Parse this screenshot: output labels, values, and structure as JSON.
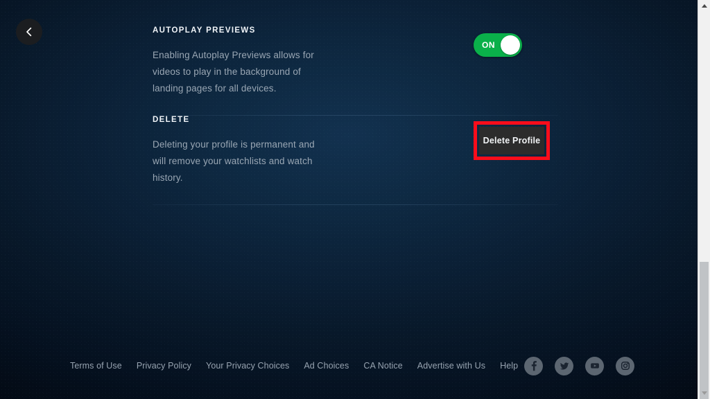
{
  "nav": {
    "back_icon": "chevron-left-icon"
  },
  "settings": {
    "rows": [
      {
        "id": "autoplay-previews",
        "title": "AUTOPLAY PREVIEWS",
        "description": "Enabling Autoplay Previews allows for videos to play in the background of landing pages for all devices.",
        "control": "toggle",
        "toggle_state": "ON",
        "toggle_on_color": "#0ab04a"
      },
      {
        "id": "delete",
        "title": "DELETE",
        "description": "Deleting your profile is permanent and will remove your watchlists and watch history.",
        "control": "button",
        "button_label": "Delete Profile",
        "button_bg": "#2c2c2c",
        "highlight_color": "#fb0d1b",
        "highlighted": true
      }
    ]
  },
  "footer": {
    "links": [
      "Terms of Use",
      "Privacy Policy",
      "Your Privacy Choices",
      "Ad Choices",
      "CA Notice",
      "Advertise with Us",
      "Help"
    ],
    "social": [
      {
        "name": "facebook-icon"
      },
      {
        "name": "twitter-icon"
      },
      {
        "name": "youtube-icon"
      },
      {
        "name": "instagram-icon"
      }
    ]
  },
  "scrollbar": {
    "up_arrow_icon": "triangle-up-icon",
    "down_arrow_icon": "triangle-down-icon",
    "thumb_position": "bottom"
  }
}
